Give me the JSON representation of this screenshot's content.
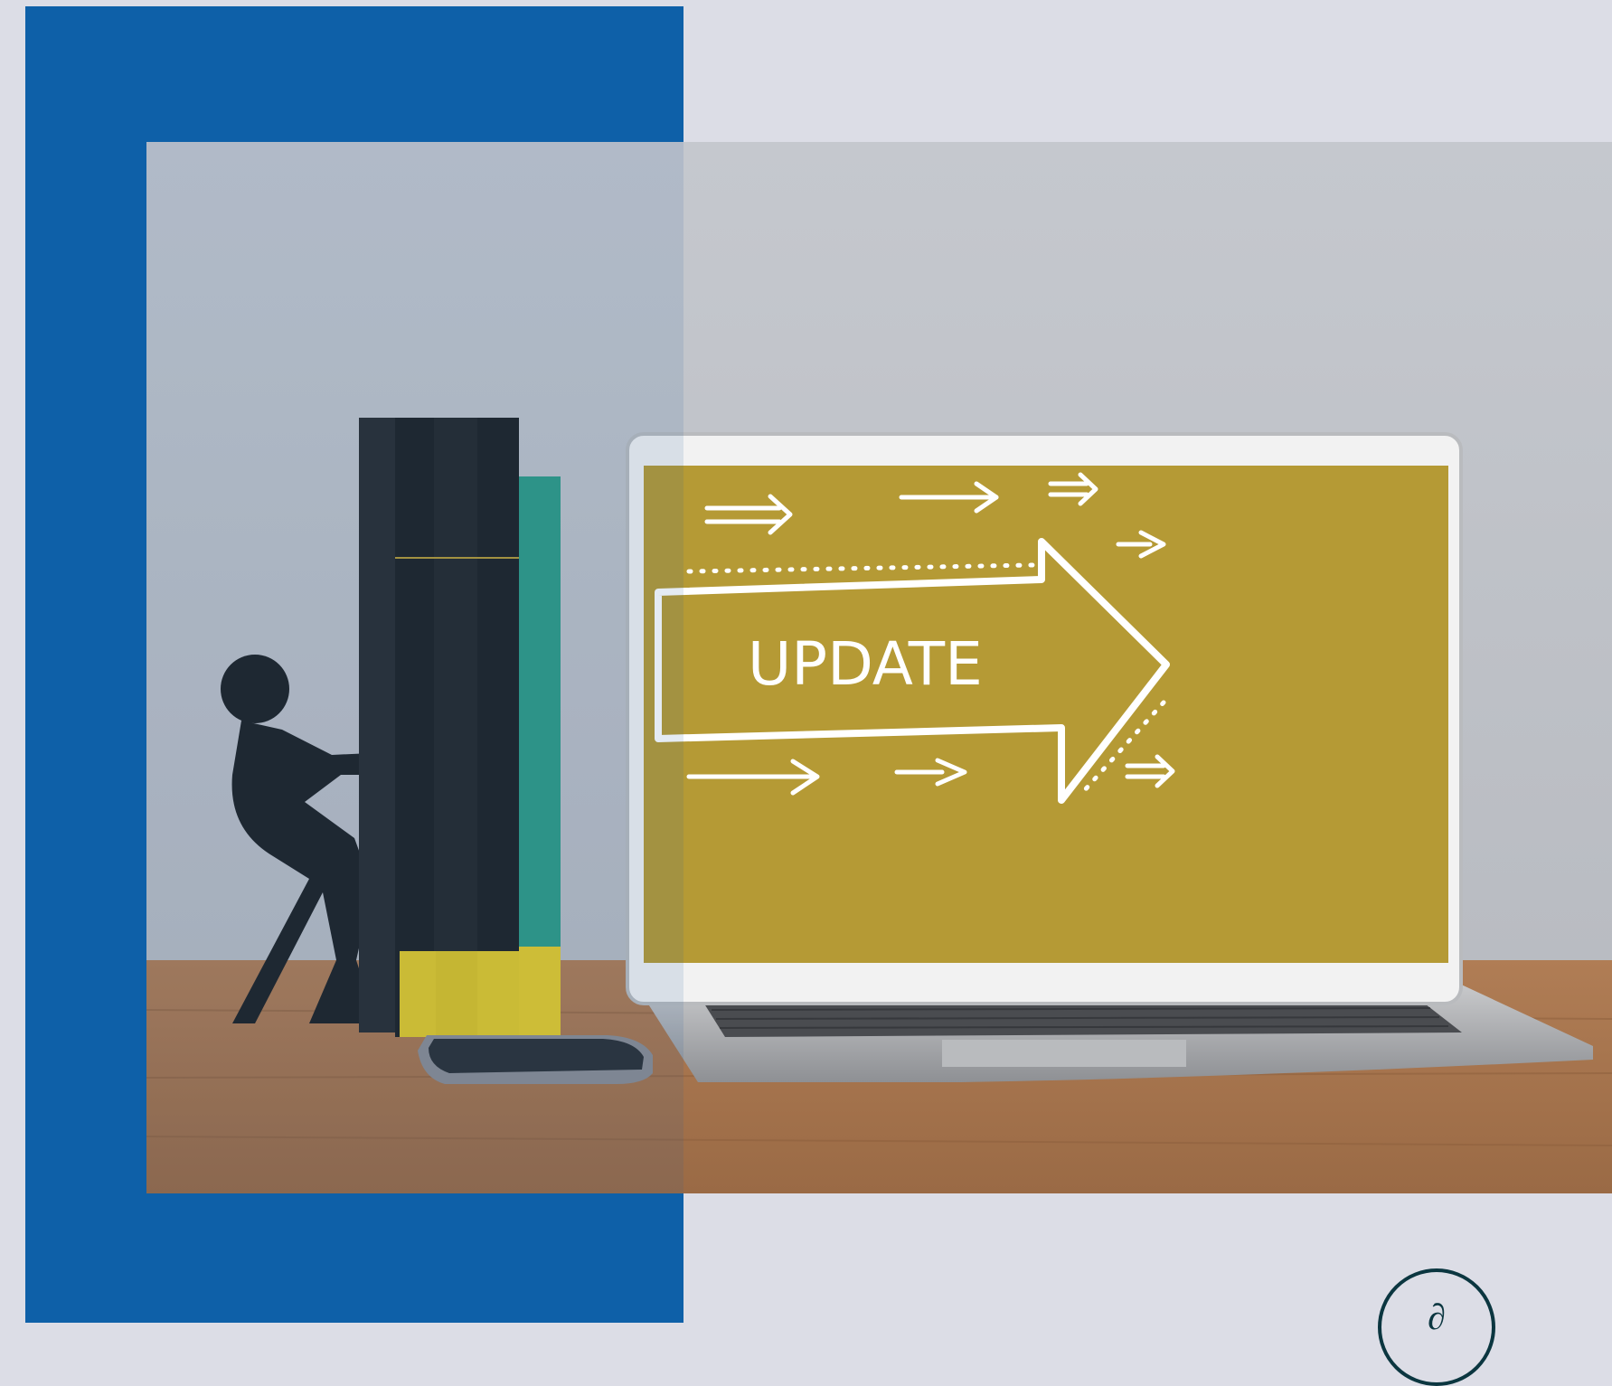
{
  "screen": {
    "word": "UPDATE"
  },
  "colors": {
    "background": "#dcdde6",
    "panel_blue": "#0e60a8",
    "screen_gold": "#b59a35",
    "wall": "#c2c5cc",
    "desk": "#a9744c",
    "book_black": "#202326",
    "book_yellow": "#e2c928",
    "book_teal": "#2f9b86",
    "logo_stroke": "#0b3640"
  },
  "icons": {
    "logo": "circle-logo-icon"
  }
}
